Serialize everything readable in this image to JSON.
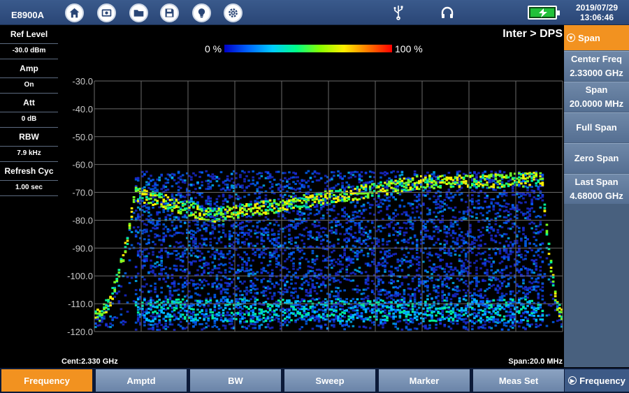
{
  "topbar": {
    "model": "E8900A",
    "buttons": [
      {
        "name": "home-icon"
      },
      {
        "name": "screenshot-icon"
      },
      {
        "name": "folder-icon"
      },
      {
        "name": "save-icon"
      },
      {
        "name": "lightbulb-icon"
      },
      {
        "name": "settings-icon"
      }
    ],
    "date": "2019/07/29",
    "time": "13:06:46"
  },
  "left_panel": [
    {
      "label": "Ref Level",
      "value": "-30.0 dBm"
    },
    {
      "label": "Amp",
      "value": "On"
    },
    {
      "label": "Att",
      "value": "0 dB"
    },
    {
      "label": "RBW",
      "value": "7.9 kHz"
    },
    {
      "label": "Refresh Cyc",
      "value": "1.00 sec"
    }
  ],
  "display": {
    "mode_title": "Inter > DPS",
    "colorbar_min": "0 %",
    "colorbar_max": "100 %",
    "center_label": "Cent:2.330 GHz",
    "span_label": "Span:20.0 MHz"
  },
  "chart_data": {
    "type": "heatmap",
    "ylim": [
      -120,
      -30
    ],
    "yticks": [
      "-30.0",
      "-40.0",
      "-50.0",
      "-60.0",
      "-70.0",
      "-80.0",
      "-90.0",
      "-100.0",
      "-110.0",
      "-120.0"
    ],
    "x_divisions": 10,
    "grid": true
  },
  "right_panel": {
    "header": "Span",
    "keys": [
      {
        "label": "Center Freq",
        "value": "2.33000 GHz"
      },
      {
        "label": "Span",
        "value": "20.0000 MHz"
      },
      {
        "label": "Full Span",
        "value": ""
      },
      {
        "label": "Zero Span",
        "value": ""
      },
      {
        "label": "Last Span",
        "value": "4.68000 GHz"
      }
    ]
  },
  "bottom_bar": {
    "keys": [
      "Frequency",
      "Amptd",
      "BW",
      "Sweep",
      "Marker",
      "Meas Set"
    ],
    "active": "Frequency",
    "right_key": "Frequency"
  },
  "colors": {
    "accent": "#f29220",
    "softkey": "#6a84a8",
    "topbar": "#2a4676"
  }
}
